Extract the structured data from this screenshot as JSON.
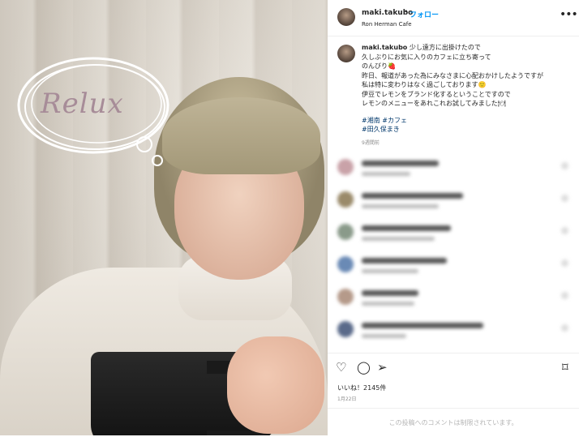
{
  "post_image": {
    "overlay_text": "Relux"
  },
  "header": {
    "username": "maki.takubo",
    "separator": "•",
    "follow_label": "フォロー",
    "location": "Ron Herman Cafe",
    "more_icon": "more-horizontal-icon"
  },
  "caption": {
    "username": "maki.takubo",
    "text": " 少し遠方に出掛けたので\n久しぶりにお気に入りのカフェに立ち寄って\nのんびり🍓\n昨日、報道があった為にみなさまに心配おかけしたようですが\n私は特に変わりはなく過ごしております🙂\n伊豆でレモンをブランド化するということですので\nレモンのメニューをあれこれお試してみました🍽",
    "hashtags": [
      "#湘南",
      "#カフェ"
    ],
    "mention": "#田久保まき",
    "time_ago": "9週間前"
  },
  "actions": {
    "like_icon": "heart-icon",
    "comment_icon": "comment-icon",
    "share_icon": "send-icon",
    "save_icon": "bookmark-icon",
    "likes_text": "いいね！2145件",
    "date": "1月22日",
    "comments_disabled": "この投稿へのコメントは制限されています。"
  },
  "colors": {
    "link_blue": "#0095f6",
    "hashtag_blue": "#00376b",
    "text": "#262626",
    "muted": "#8e8e8e"
  }
}
